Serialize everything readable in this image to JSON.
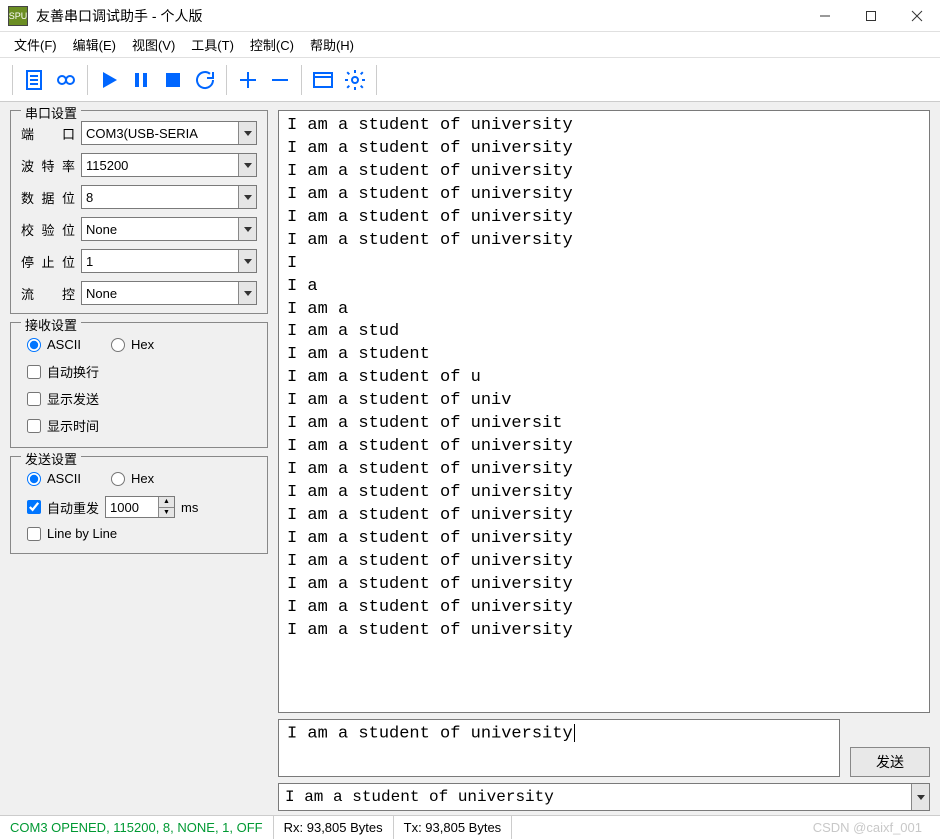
{
  "window": {
    "icon_label": "SPU",
    "title": "友善串口调试助手 - 个人版"
  },
  "menu": {
    "file": "文件(F)",
    "edit": "编辑(E)",
    "view": "视图(V)",
    "tools": "工具(T)",
    "control": "控制(C)",
    "help": "帮助(H)"
  },
  "serial_settings": {
    "title": "串口设置",
    "port_label": "端　口",
    "port_value": "COM3(USB-SERIA",
    "baud_label": "波特率",
    "baud_value": "115200",
    "databits_label": "数据位",
    "databits_value": "8",
    "parity_label": "校验位",
    "parity_value": "None",
    "stopbits_label": "停止位",
    "stopbits_value": "1",
    "flow_label": "流　控",
    "flow_value": "None"
  },
  "receive_settings": {
    "title": "接收设置",
    "ascii_label": "ASCII",
    "hex_label": "Hex",
    "auto_wrap": "自动换行",
    "show_send": "显示发送",
    "show_time": "显示时间"
  },
  "send_settings": {
    "title": "发送设置",
    "ascii_label": "ASCII",
    "hex_label": "Hex",
    "auto_resend": "自动重发",
    "interval": "1000",
    "unit": "ms",
    "line_by_line": "Line by Line"
  },
  "output_lines": [
    "I am a student of university",
    "I am a student of university",
    "I am a student of university",
    "I am a student of university",
    "I am a student of university",
    "I am a student of university",
    "I",
    "I a",
    "I am a",
    "I am a stud",
    "I am a student",
    "I am a student of u",
    "I am a student of univ",
    "I am a student of universit",
    "I am a student of university",
    "I am a student of university",
    "I am a student of university",
    "I am a student of university",
    "I am a student of university",
    "I am a student of university",
    "I am a student of university",
    "I am a student of university",
    "I am a student of university"
  ],
  "send_input": "I am a student of university",
  "send_button": "发送",
  "history_value": "I am a student of university",
  "status": {
    "conn": "COM3 OPENED, 115200, 8, NONE, 1, OFF",
    "rx": "Rx: 93,805 Bytes",
    "tx": "Tx: 93,805 Bytes"
  },
  "watermark": "CSDN @caixf_001"
}
